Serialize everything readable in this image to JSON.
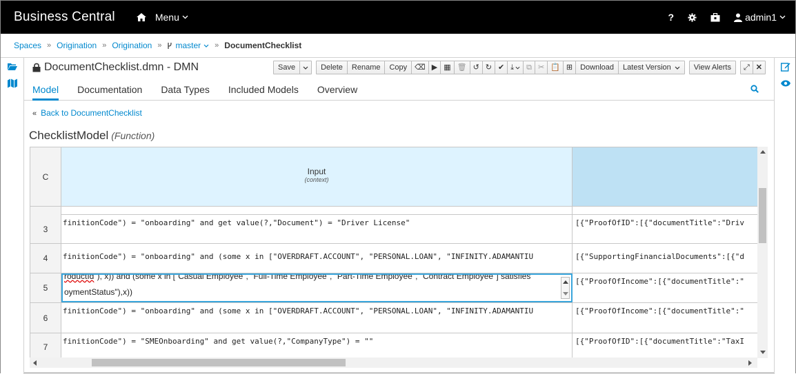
{
  "topbar": {
    "brand": "Business Central",
    "menu_label": "Menu",
    "help": "?",
    "user": "admin1"
  },
  "breadcrumb": [
    "Spaces",
    "Origination",
    "Origination",
    "master",
    "DocumentChecklist"
  ],
  "editor": {
    "title": "DocumentChecklist.dmn - DMN"
  },
  "toolbar": {
    "save": "Save",
    "delete": "Delete",
    "rename": "Rename",
    "copy": "Copy",
    "download": "Download",
    "latest_version": "Latest Version",
    "view_alerts": "View Alerts"
  },
  "tabs": [
    "Model",
    "Documentation",
    "Data Types",
    "Included Models",
    "Overview"
  ],
  "back_link": "Back to DocumentChecklist",
  "function": {
    "name": "ChecklistModel",
    "kind": "(Function)"
  },
  "grid": {
    "corner": "C",
    "input_header": "Input",
    "input_sub": "(context)",
    "rows": [
      {
        "num": "3",
        "input": "finitionCode\") = \"onboarding\" and get value(?,\"Document\") = \"Driver License\"",
        "output": "[{\"ProofOfID\":[{\"documentTitle\":\"Driv"
      },
      {
        "num": "4",
        "input": "finitionCode\") = \"onboarding\" and (some x in [\"OVERDRAFT.ACCOUNT\", \"PERSONAL.LOAN\", \"INFINITY.ADAMANTIU",
        "output": "[{\"SupportingFinancialDocuments\":[{\"d"
      },
      {
        "num": "5",
        "input_line1_a": "roductId",
        "input_line1_b": "\"), x)) and (some x in [\"Casual Employee\", \"Full-Time Employee\", \"Part-Time Employee\", \"Contract Employee\"] satisfies",
        "input_line2": "oymentStatus\"),x))",
        "output": "[{\"ProofOfIncome\":[{\"documentTitle\":\""
      },
      {
        "num": "6",
        "input": "finitionCode\") = \"onboarding\" and (some x in [\"OVERDRAFT.ACCOUNT\", \"PERSONAL.LOAN\", \"INFINITY.ADAMANTIU",
        "output": "[{\"ProofOfIncome\":[{\"documentTitle\":\""
      },
      {
        "num": "7",
        "input": "finitionCode\") = \"SMEOnboarding\" and get value(?,\"CompanyType\") = \"\"",
        "output": "[{\"ProofOfID\":[{\"documentTitle\":\"TaxI"
      }
    ]
  },
  "colors": {
    "accent": "#0088ce",
    "input_header_bg": "#def3ff",
    "output_header_bg": "#bee1f4"
  }
}
